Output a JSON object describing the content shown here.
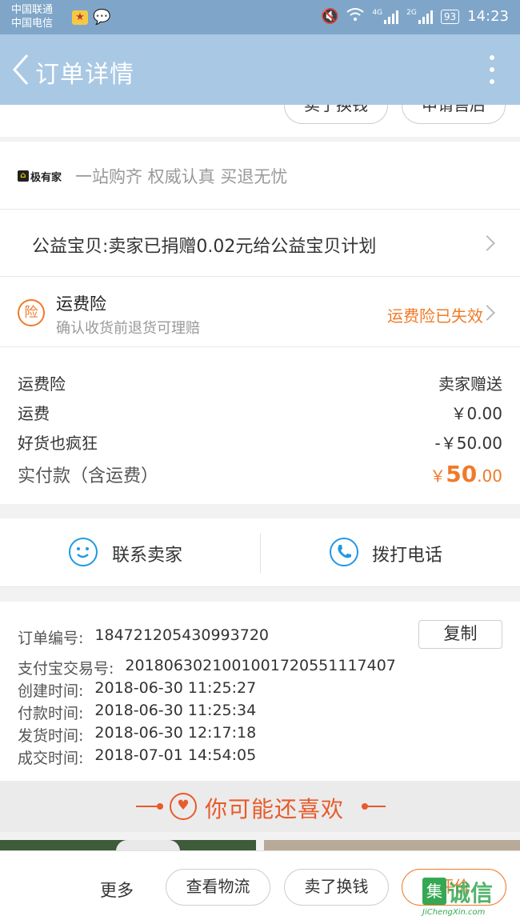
{
  "status_bar": {
    "carrier_1": "中国联通",
    "carrier_2": "中国电信",
    "net_1": "4G",
    "net_2": "2G",
    "battery": "93",
    "time": "14:23"
  },
  "header": {
    "title": "订单详情",
    "bg_color": "#a9c8e4"
  },
  "top_actions": {
    "btn_1": "卖了换钱",
    "btn_2": "申请售后"
  },
  "brand": {
    "logo": "极有家",
    "slogan": "一站购齐 权威认真 买退无忧"
  },
  "charity": {
    "text": "公益宝贝:卖家已捐赠0.02元给公益宝贝计划"
  },
  "insurance": {
    "icon_char": "险",
    "title": "运费险",
    "subtitle": "确认收货前退货可理赔",
    "status": "运费险已失效",
    "accent_color": "#f07a28"
  },
  "fees": {
    "rows": [
      {
        "label": "运费险",
        "value": "卖家赠送"
      },
      {
        "label": "运费",
        "value": "￥0.00"
      },
      {
        "label": "好货也疯狂",
        "value": "-￥50.00"
      }
    ],
    "total_label": "实付款（含运费）",
    "total_currency": "￥",
    "total_int": "50",
    "total_dec": ".00"
  },
  "contact": {
    "seller_label": "联系卖家",
    "call_label": "拨打电话",
    "icon_color": "#1f9ae0"
  },
  "order_info": {
    "copy_label": "复制",
    "rows": [
      {
        "label": "订单编号:",
        "value": "184721205430993720"
      },
      {
        "label": "支付宝交易号:",
        "value": "2018063021001001720551117407"
      },
      {
        "label": "创建时间:",
        "value": "2018-06-30 11:25:27"
      },
      {
        "label": "付款时间:",
        "value": "2018-06-30 11:25:34"
      },
      {
        "label": "发货时间:",
        "value": "2018-06-30 12:17:18"
      },
      {
        "label": "成交时间:",
        "value": "2018-07-01 14:54:05"
      }
    ]
  },
  "recommend": {
    "title": "你可能还喜欢",
    "color": "#e85b2b"
  },
  "bottom_bar": {
    "more": "更多",
    "logistics": "查看物流",
    "sell": "卖了换钱",
    "review": "评价"
  },
  "watermark": {
    "mark": "集",
    "text": "诚信",
    "url": "JiChengXin.com"
  }
}
